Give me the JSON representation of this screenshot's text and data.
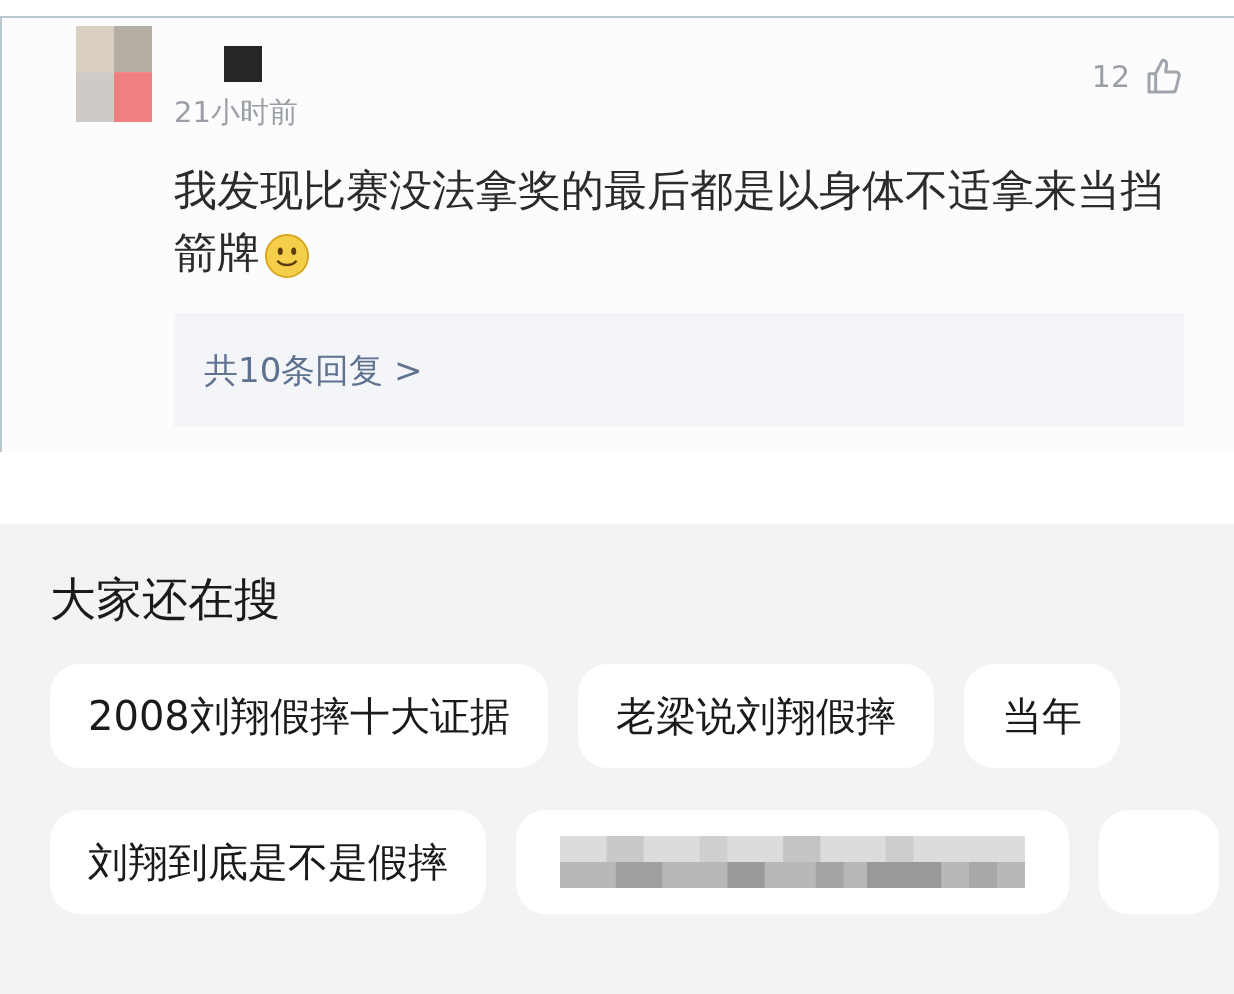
{
  "comment": {
    "time": "21小时前",
    "likes": "12",
    "text": "我发现比赛没法拿奖的最后都是以身体不适拿来当挡箭牌",
    "replies_link": "共10条回复 >"
  },
  "search_panel": {
    "title": "大家还在搜",
    "rows": [
      [
        {
          "kind": "text",
          "label": "2008刘翔假摔十大证据"
        },
        {
          "kind": "text",
          "label": "老梁说刘翔假摔"
        },
        {
          "kind": "text",
          "label": "当年"
        }
      ],
      [
        {
          "kind": "text",
          "label": "刘翔到底是不是假摔"
        },
        {
          "kind": "redacted"
        },
        {
          "kind": "blank"
        }
      ]
    ]
  }
}
